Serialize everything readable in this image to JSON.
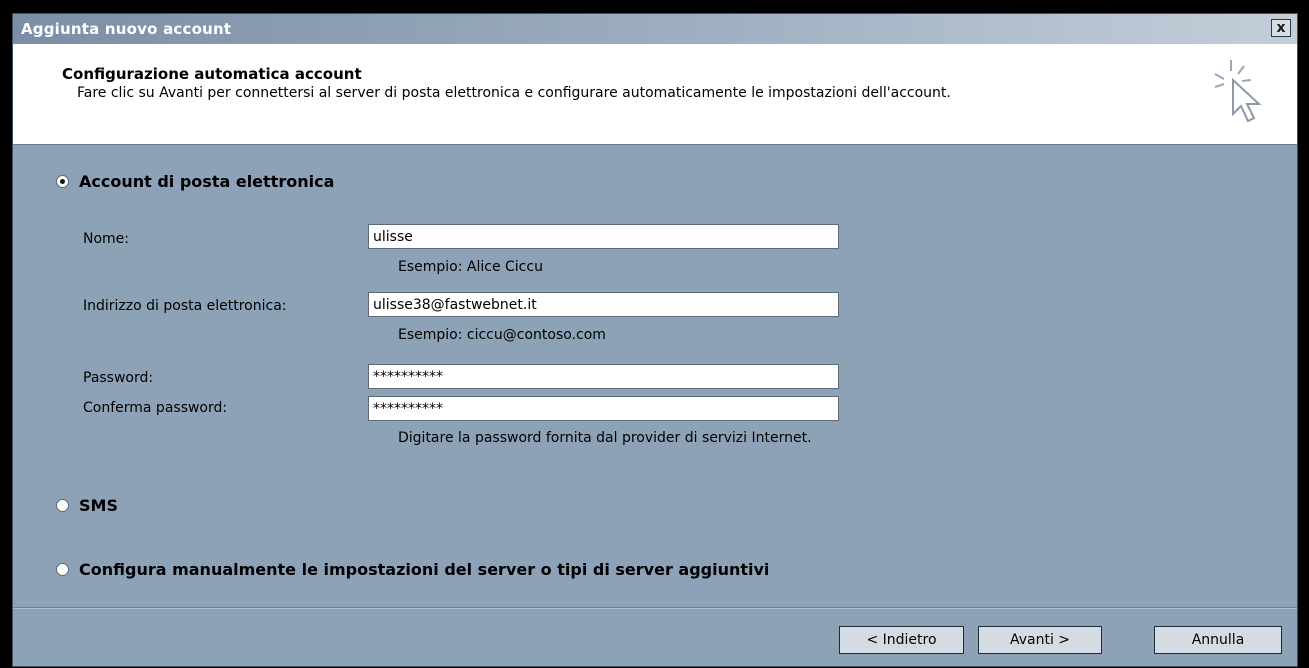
{
  "window": {
    "title": "Aggiunta nuovo account",
    "close_label": "x"
  },
  "header": {
    "title": "Configurazione automatica account",
    "description": "Fare clic su Avanti per connettersi al server di posta elettronica e configurare automaticamente le impostazioni dell'account."
  },
  "options": {
    "email_account": {
      "label": "Account di posta elettronica",
      "selected": true
    },
    "sms": {
      "label": "SMS",
      "selected": false
    },
    "manual": {
      "label": "Configura manualmente le impostazioni del server o tipi di server aggiuntivi",
      "selected": false
    }
  },
  "form": {
    "name": {
      "label": "Nome:",
      "value": "ulisse",
      "hint": "Esempio: Alice Ciccu"
    },
    "email": {
      "label": "Indirizzo di posta elettronica:",
      "value": "ulisse38@fastwebnet.it",
      "hint": "Esempio: ciccu@contoso.com"
    },
    "password": {
      "label": "Password:",
      "value": "**********"
    },
    "confirm_password": {
      "label": "Conferma password:",
      "value": "**********",
      "hint": "Digitare la password fornita dal provider di servizi Internet."
    }
  },
  "buttons": {
    "back": "< Indietro",
    "next": "Avanti >",
    "cancel": "Annulla"
  },
  "icons": {
    "header": "cursor-click-icon"
  }
}
